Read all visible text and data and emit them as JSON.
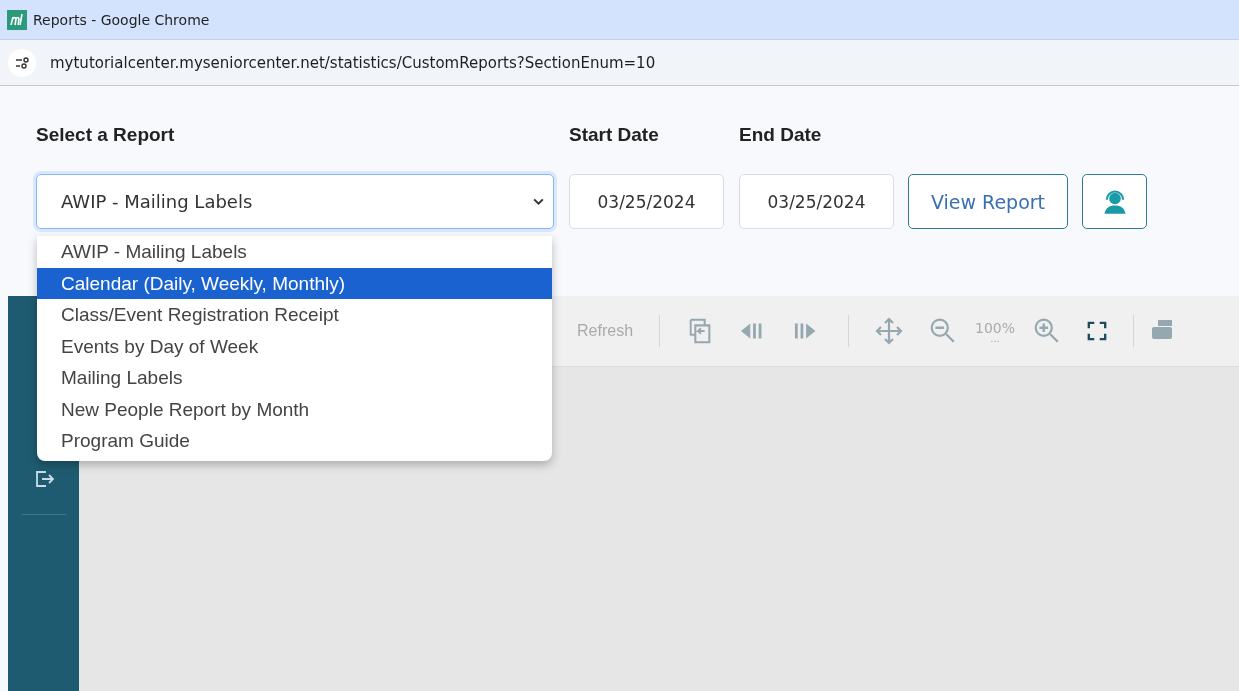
{
  "window": {
    "title": "Reports - Google Chrome"
  },
  "address_bar": {
    "url": "mytutorialcenter.myseniorcenter.net/statistics/CustomReports?SectionEnum=10"
  },
  "form": {
    "report_label": "Select a Report",
    "report_value": "AWIP - Mailing Labels",
    "start_label": "Start Date",
    "start_value": "03/25/2024",
    "end_label": "End Date",
    "end_value": "03/25/2024",
    "view_button": "View Report"
  },
  "dropdown": [
    {
      "label": "AWIP - Mailing Labels",
      "selected": false
    },
    {
      "label": "Calendar (Daily, Weekly, Monthly)",
      "selected": true
    },
    {
      "label": "Class/Event Registration Receipt",
      "selected": false
    },
    {
      "label": "Events by Day of Week",
      "selected": false
    },
    {
      "label": "Mailing Labels",
      "selected": false
    },
    {
      "label": "New People Report by Month",
      "selected": false
    },
    {
      "label": "Program Guide",
      "selected": false
    }
  ],
  "toolbar": {
    "refresh": "Refresh",
    "zoom": "100%",
    "zoom_more": "..."
  }
}
